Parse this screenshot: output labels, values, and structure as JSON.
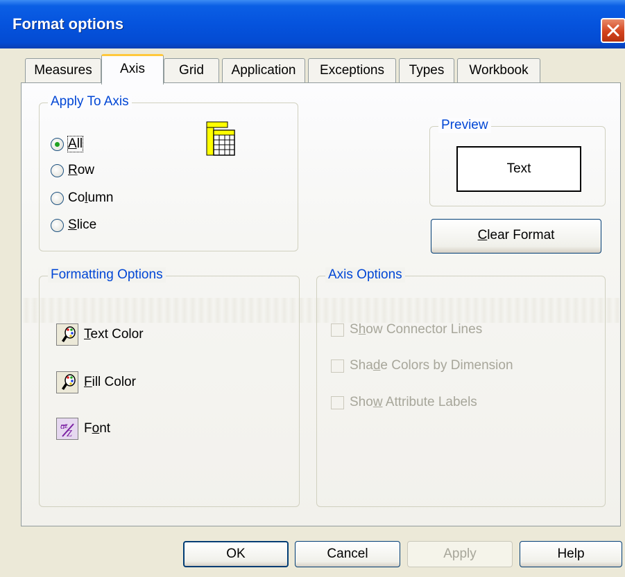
{
  "window": {
    "title": "Format options"
  },
  "tabs": [
    {
      "label": "Measures",
      "active": false
    },
    {
      "label": "Axis",
      "active": true
    },
    {
      "label": "Grid",
      "active": false
    },
    {
      "label": "Application",
      "active": false
    },
    {
      "label": "Exceptions",
      "active": false
    },
    {
      "label": "Types",
      "active": false
    },
    {
      "label": "Workbook",
      "active": false
    }
  ],
  "apply_to_axis": {
    "legend": "Apply To Axis",
    "options": [
      {
        "pre": "",
        "mn": "A",
        "post": "ll",
        "checked": true
      },
      {
        "pre": "",
        "mn": "R",
        "post": "ow",
        "checked": false
      },
      {
        "pre": "Co",
        "mn": "l",
        "post": "umn",
        "checked": false
      },
      {
        "pre": "",
        "mn": "S",
        "post": "lice",
        "checked": false
      }
    ],
    "icon": "grid-table-icon"
  },
  "preview": {
    "legend": "Preview",
    "text": "Text"
  },
  "clear_format": {
    "mn": "C",
    "rest": "lear Format"
  },
  "formatting_options": {
    "legend": "Formatting Options",
    "items": [
      {
        "mn": "T",
        "rest": "ext Color",
        "icon": "color-palette-icon"
      },
      {
        "mn": "F",
        "rest": "ill Color",
        "icon": "color-palette-icon"
      },
      {
        "pre": "F",
        "mn": "o",
        "rest": "nt",
        "icon": "font-icon"
      }
    ]
  },
  "axis_options": {
    "legend": "Axis Options",
    "items": [
      {
        "pre": "S",
        "mn": "h",
        "post": "ow Connector Lines",
        "checked": false,
        "enabled": false
      },
      {
        "pre": "Sha",
        "mn": "d",
        "post": "e Colors by Dimension",
        "checked": false,
        "enabled": false
      },
      {
        "pre": "Sho",
        "mn": "w",
        "post": " Attribute Labels",
        "checked": false,
        "enabled": false
      }
    ]
  },
  "buttons": {
    "ok": "OK",
    "cancel": "Cancel",
    "apply": "Apply",
    "help": "Help"
  },
  "colors": {
    "accent": "#0046d5",
    "titlebar": "#0553dd",
    "tab_highlight": "#ffc83c"
  }
}
